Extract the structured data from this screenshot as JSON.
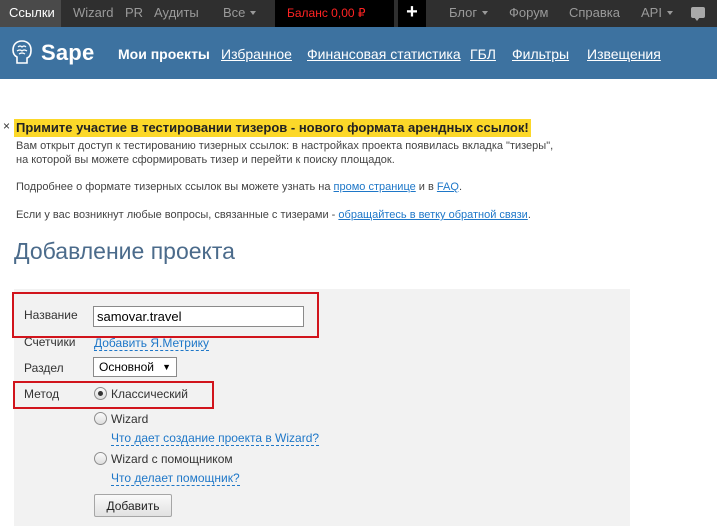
{
  "topbar": {
    "items": [
      {
        "label": "Ссылки",
        "active": true
      },
      {
        "label": "Wizard"
      },
      {
        "label": "PR"
      },
      {
        "label": "Аудиты"
      },
      {
        "label": "Все",
        "dropdown": true
      }
    ],
    "balance_label": "Баланс 0,00 ₽",
    "plus_label": "+",
    "right_items": [
      {
        "label": "Блог",
        "dropdown": true
      },
      {
        "label": "Форум"
      },
      {
        "label": "Справка"
      },
      {
        "label": "API",
        "dropdown": true
      }
    ],
    "colors": {
      "bar": "#2f2f2f",
      "balance": "#ff2323"
    }
  },
  "nav": {
    "logo": "Sape",
    "items": [
      {
        "label": "Мои проекты",
        "current": true
      },
      {
        "label": "Избранное"
      },
      {
        "label": "Финансовая статистика"
      },
      {
        "label": "ГБЛ"
      },
      {
        "label": "Фильтры"
      },
      {
        "label": "Извещения"
      }
    ],
    "color": "#3d72a0"
  },
  "notice": {
    "close": "×",
    "title": "Примите участие в тестировании тизеров - нового формата арендных ссылок!",
    "line1": "Вам открыт доступ к тестированию тизерных ссылок: в настройках проекта появилась вкладка \"тизеры\",",
    "line2": "на которой вы можете сформировать тизер и перейти к поиску площадок.",
    "line3_prefix": "Подробнее о формате тизерных ссылок вы можете узнать на ",
    "line3_link1": "промо странице",
    "line3_mid": " и в ",
    "line3_link2": "FAQ",
    "line3_suffix": ".",
    "line4_prefix": "Если у вас возникнут любые вопросы, связанные с тизерами - ",
    "line4_link": "обращайтесь в ветку обратной связи",
    "line4_suffix": "."
  },
  "page_title": "Добавление проекта",
  "form": {
    "name_label": "Название",
    "name_value": "samovar.travel",
    "counters_label": "Счетчики",
    "counters_link": "Добавить Я.Метрику",
    "section_label": "Раздел",
    "section_value": "Основной",
    "method_label": "Метод",
    "methods": [
      {
        "label": "Классический",
        "checked": true
      },
      {
        "label": "Wizard",
        "checked": false,
        "help": "Что дает создание проекта в Wizard?"
      },
      {
        "label": "Wizard с помощником",
        "checked": false,
        "help": "Что делает помощник?"
      }
    ],
    "submit_label": "Добавить"
  },
  "highlight_color": "#d1141c"
}
